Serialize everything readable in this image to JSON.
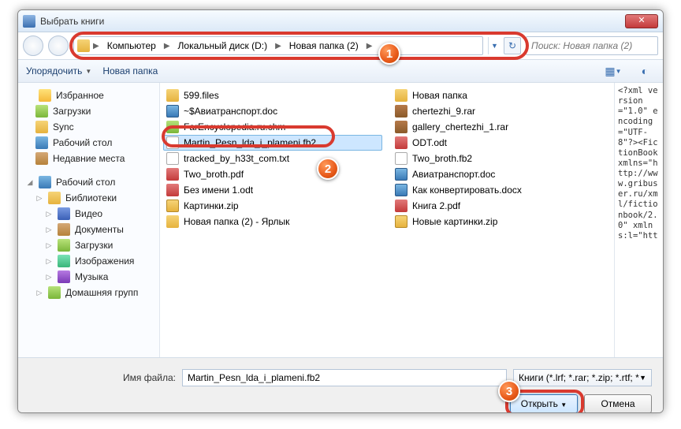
{
  "title": "Выбрать книги",
  "breadcrumb": {
    "seg1": "Компьютер",
    "seg2": "Локальный диск (D:)",
    "seg3": "Новая папка (2)"
  },
  "search_placeholder": "Поиск: Новая папка (2)",
  "toolbar": {
    "organize": "Упорядочить",
    "newfolder": "Новая папка"
  },
  "sidebar": {
    "fav": "Избранное",
    "dl": "Загрузки",
    "sync": "Sync",
    "desk": "Рабочий стол",
    "rec": "Недавние места",
    "desk2": "Рабочий стол",
    "lib": "Библиотеки",
    "vid": "Видео",
    "doc": "Документы",
    "dl2": "Загрузки",
    "img": "Изображения",
    "mus": "Музыка",
    "home": "Домашняя групп"
  },
  "files_left": [
    {
      "icon": "f-folder",
      "name": "599.files"
    },
    {
      "icon": "f-doc",
      "name": "~$Авиатранспорт.doc"
    },
    {
      "icon": "f-chm",
      "name": "FarEncyclopedia.ru.chm"
    },
    {
      "icon": "f-txt",
      "name": "Martin_Pesn_lda_i_plameni.fb2",
      "selected": true
    },
    {
      "icon": "f-txt",
      "name": "tracked_by_h33t_com.txt"
    },
    {
      "icon": "f-pdf",
      "name": "Two_broth.pdf"
    },
    {
      "icon": "f-odt",
      "name": "Без имени 1.odt"
    },
    {
      "icon": "f-zip",
      "name": "Картинки.zip"
    },
    {
      "icon": "f-lnk",
      "name": "Новая папка (2) - Ярлык"
    }
  ],
  "files_right": [
    {
      "icon": "f-folder",
      "name": "Новая папка"
    },
    {
      "icon": "f-rar",
      "name": "chertezhi_9.rar"
    },
    {
      "icon": "f-rar",
      "name": "gallery_chertezhi_1.rar"
    },
    {
      "icon": "f-odt",
      "name": "ODT.odt"
    },
    {
      "icon": "f-fb2",
      "name": "Two_broth.fb2"
    },
    {
      "icon": "f-doc",
      "name": "Авиатранспорт.doc"
    },
    {
      "icon": "f-doc",
      "name": "Как конвертировать.docx"
    },
    {
      "icon": "f-pdf",
      "name": "Книга 2.pdf"
    },
    {
      "icon": "f-zip",
      "name": "Новые картинки.zip"
    }
  ],
  "preview_text": "<?xml version=\"1.0\" encoding=\"UTF-8\"?><FictionBook xmlns=\"http://www.gribuser.ru/xml/fictionbook/2.0\" xmlns:l=\"htt",
  "footer": {
    "label": "Имя файла:",
    "filename": "Martin_Pesn_lda_i_plameni.fb2",
    "filetype": "Книги (*.lrf; *.rar; *.zip; *.rtf; *.lit",
    "open": "Открыть",
    "cancel": "Отмена"
  },
  "callouts": {
    "c1": "1",
    "c2": "2",
    "c3": "3"
  }
}
